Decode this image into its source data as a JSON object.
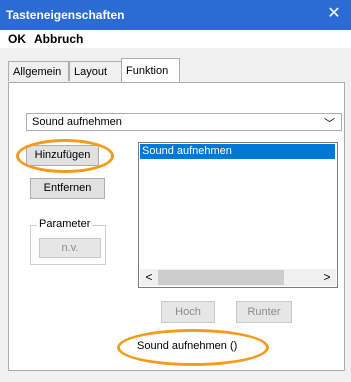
{
  "window": {
    "title": "Tasteneigenschaften",
    "close_glyph": "✕"
  },
  "menu": {
    "ok": "OK",
    "cancel": "Abbruch"
  },
  "tabs": [
    {
      "label": "Allgemein",
      "active": false
    },
    {
      "label": "Layout",
      "active": false
    },
    {
      "label": "Funktion",
      "active": true
    }
  ],
  "function_select": {
    "value": "Sound aufnehmen",
    "chevron": "﹀"
  },
  "buttons": {
    "add": "Hinzufügen",
    "remove": "Entfernen",
    "param_value": "n.v.",
    "up": "Hoch",
    "down": "Runter"
  },
  "parameter_group": {
    "label": "Parameter"
  },
  "action_list": {
    "items": [
      "Sound aufnehmen"
    ],
    "scroll_left": "<",
    "scroll_right": ">"
  },
  "result_text": "Sound aufnehmen ()",
  "colors": {
    "titlebar": "#2b6bd3",
    "selection": "#0078d7",
    "annotation": "#f39c1b"
  }
}
